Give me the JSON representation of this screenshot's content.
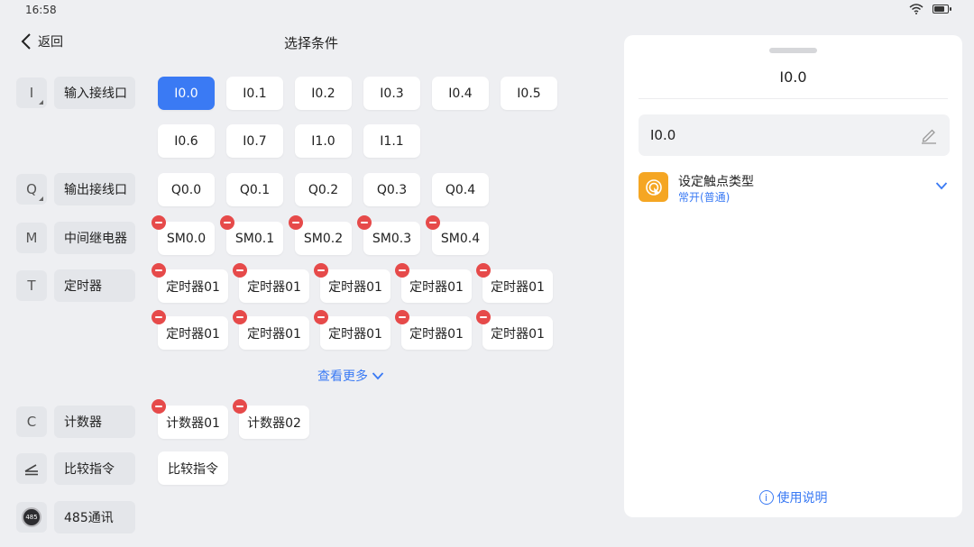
{
  "status": {
    "time": "16:58",
    "battery_level": 0.8
  },
  "header": {
    "back_label": "返回",
    "title": "选择条件"
  },
  "categories": [
    {
      "icon_text": "I",
      "label": "输入接线口"
    },
    {
      "icon_text": "Q",
      "label": "输出接线口"
    },
    {
      "icon_text": "M",
      "label": "中间继电器"
    },
    {
      "icon_text": "T",
      "label": "定时器"
    },
    {
      "icon_text": "C",
      "label": "计数器"
    },
    {
      "icon_text": "",
      "label": "比较指令"
    },
    {
      "icon_text": "485",
      "label": "485通讯"
    }
  ],
  "inputs": [
    "I0.0",
    "I0.1",
    "I0.2",
    "I0.3",
    "I0.4",
    "I0.5",
    "I0.6",
    "I0.7",
    "I1.0",
    "I1.1"
  ],
  "outputs": [
    "Q0.0",
    "Q0.1",
    "Q0.2",
    "Q0.3",
    "Q0.4"
  ],
  "relays": [
    "SM0.0",
    "SM0.1",
    "SM0.2",
    "SM0.3",
    "SM0.4"
  ],
  "timers": [
    "定时器01",
    "定时器01",
    "定时器01",
    "定时器01",
    "定时器01",
    "定时器01",
    "定时器01",
    "定时器01",
    "定时器01",
    "定时器01"
  ],
  "show_more": "查看更多",
  "counters": [
    "计数器01",
    "计数器02"
  ],
  "compare": [
    "比较指令"
  ],
  "panel": {
    "title": "I0.0",
    "name_value": "I0.0",
    "contact_title": "设定触点类型",
    "contact_value": "常开(普通)",
    "help_label": "使用说明",
    "help_icon_text": "i"
  },
  "colors": {
    "accent": "#3a7af4",
    "delete": "#e64a4a",
    "contact_icon": "#f5a623"
  }
}
